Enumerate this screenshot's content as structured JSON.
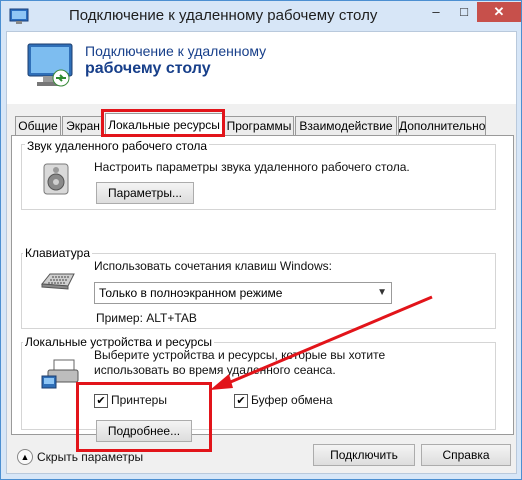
{
  "window": {
    "title": "Подключение к удаленному рабочему столу",
    "min_glyph": "–",
    "max_glyph": "□",
    "close_glyph": "✕"
  },
  "header": {
    "line1": "Подключение к удаленному",
    "line2": "рабочему столу"
  },
  "tabs": [
    {
      "label": "Общие"
    },
    {
      "label": "Экран"
    },
    {
      "label": "Локальные ресурсы"
    },
    {
      "label": "Программы"
    },
    {
      "label": "Взаимодействие"
    },
    {
      "label": "Дополнительно"
    }
  ],
  "active_tab_index": 2,
  "sound": {
    "title": "Звук удаленного рабочего стола",
    "description": "Настроить параметры звука удаленного рабочего стола.",
    "button": "Параметры..."
  },
  "keyboard": {
    "title": "Клавиатура",
    "description": "Использовать сочетания клавиш Windows:",
    "select_value": "Только в полноэкранном режиме",
    "example": "Пример: ALT+TAB"
  },
  "devices": {
    "title": "Локальные устройства и ресурсы",
    "description_line1": "Выберите устройства и ресурсы, которые вы хотите",
    "description_line2": "использовать во время удаленного сеанса.",
    "printers_label": "Принтеры",
    "printers_checked": true,
    "clipboard_label": "Буфер обмена",
    "clipboard_checked": true,
    "more_button": "Подробнее..."
  },
  "footer": {
    "hide_options": "Скрыть параметры",
    "connect": "Подключить",
    "help": "Справка"
  },
  "colors": {
    "highlight": "#e2141a",
    "header_text": "#173f8a"
  }
}
